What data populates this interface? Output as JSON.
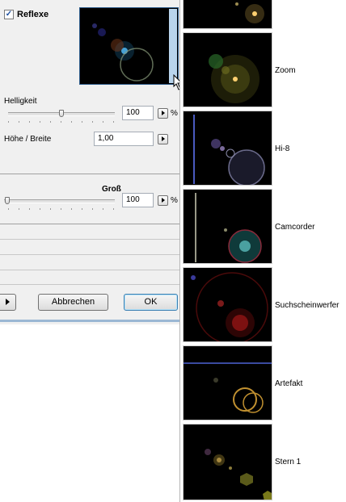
{
  "dialog": {
    "reflexe_checkbox": {
      "checked": true,
      "mark": "✓"
    },
    "reflexe_label": "Reflexe",
    "helligkeit_label": "Helligkeit",
    "helligkeit_value": "100",
    "helligkeit_unit": "%",
    "hoehe_breite_label": "Höhe / Breite",
    "hoehe_breite_value": "1,00",
    "gross_label": "Groß",
    "gross_value": "100",
    "gross_unit": "%",
    "cancel_label": "Abbrechen",
    "ok_label": "OK"
  },
  "presets": [
    {
      "label": ""
    },
    {
      "label": "Zoom"
    },
    {
      "label": "Hi-8"
    },
    {
      "label": "Camcorder"
    },
    {
      "label": "Suchscheinwerfer"
    },
    {
      "label": "Artefakt"
    },
    {
      "label": "Stern 1"
    }
  ],
  "colors": {
    "accent": "#2b5a8a",
    "dialog_bg": "#f0f0f0"
  },
  "icons": [
    "check-icon",
    "arrow-right-icon",
    "mouse-cursor-icon"
  ]
}
